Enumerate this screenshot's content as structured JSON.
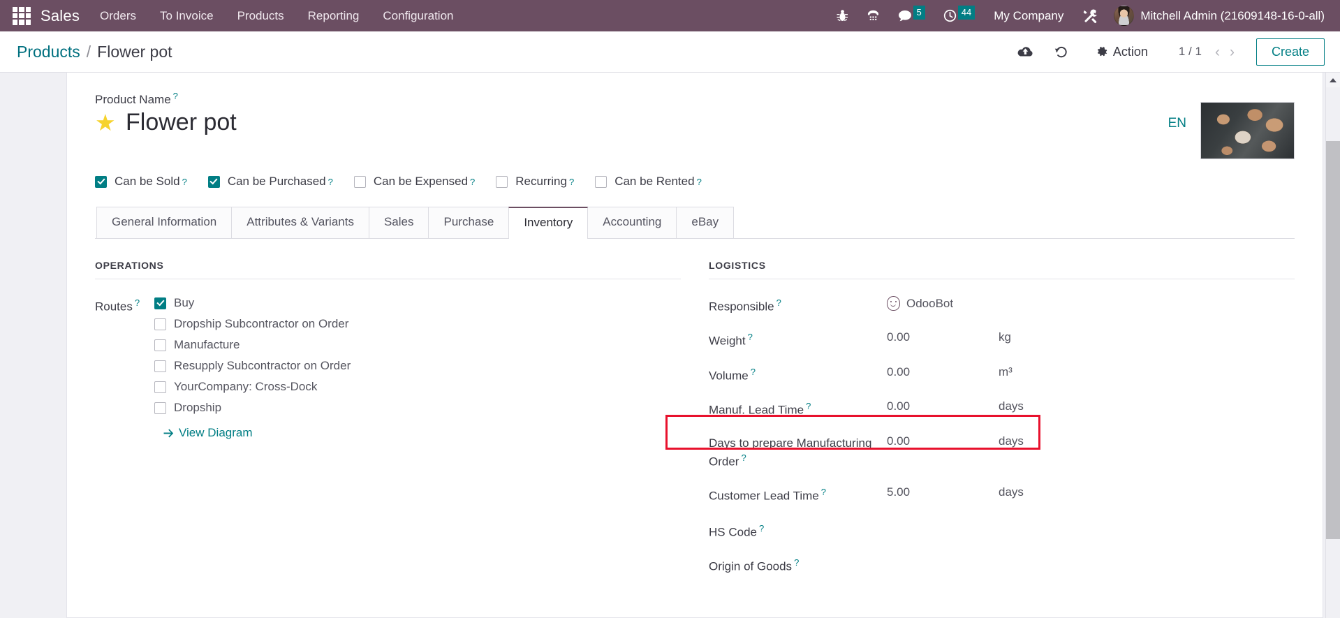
{
  "navbar": {
    "apps_icon": "apps-grid-icon",
    "brand": "Sales",
    "menu": [
      {
        "label": "Orders"
      },
      {
        "label": "To Invoice"
      },
      {
        "label": "Products"
      },
      {
        "label": "Reporting"
      },
      {
        "label": "Configuration"
      }
    ],
    "icons": [
      {
        "name": "bug-icon",
        "glyph": "🐞",
        "badge": null
      },
      {
        "name": "voip-phone-icon",
        "glyph": "☎",
        "badge": null
      },
      {
        "name": "messages-icon",
        "glyph": "💬",
        "badge": "5"
      },
      {
        "name": "activities-clock-icon",
        "glyph": "🕒",
        "badge": "44"
      }
    ],
    "company": "My Company",
    "tools_icon": "wrench-screwdriver-icon",
    "user": "Mitchell Admin (21609148-16-0-all)",
    "badge_color": "#017e84",
    "bg_color": "#6b4e62"
  },
  "control_panel": {
    "breadcrumb_root": "Products",
    "breadcrumb_sep": "/",
    "breadcrumb_current": "Flower pot",
    "upload_icon": "cloud-upload-icon",
    "discard_icon": "undo-discard-icon",
    "action_label": "Action",
    "action_icon": "gear-icon",
    "pager": "1 / 1",
    "prev_icon": "chevron-left-icon",
    "next_icon": "chevron-right-icon",
    "create_label": "Create",
    "accent_color": "#017e84"
  },
  "form": {
    "product_name_label": "Product Name",
    "product_name": "Flower pot",
    "favorite_star": "★",
    "language": "EN",
    "image_alt": "product-image-flower-pots",
    "checkboxes": [
      {
        "label": "Can be Sold",
        "checked": true
      },
      {
        "label": "Can be Purchased",
        "checked": true
      },
      {
        "label": "Can be Expensed",
        "checked": false
      },
      {
        "label": "Recurring",
        "checked": false
      },
      {
        "label": "Can be Rented",
        "checked": false
      }
    ],
    "tabs": [
      {
        "label": "General Information",
        "active": false
      },
      {
        "label": "Attributes & Variants",
        "active": false
      },
      {
        "label": "Sales",
        "active": false
      },
      {
        "label": "Purchase",
        "active": false
      },
      {
        "label": "Inventory",
        "active": true
      },
      {
        "label": "Accounting",
        "active": false
      },
      {
        "label": "eBay",
        "active": false
      }
    ],
    "operations": {
      "title": "Operations",
      "routes_label": "Routes",
      "routes": [
        {
          "label": "Buy",
          "checked": true
        },
        {
          "label": "Dropship Subcontractor on Order",
          "checked": false
        },
        {
          "label": "Manufacture",
          "checked": false
        },
        {
          "label": "Resupply Subcontractor on Order",
          "checked": false
        },
        {
          "label": "YourCompany: Cross-Dock",
          "checked": false
        },
        {
          "label": "Dropship",
          "checked": false
        }
      ],
      "view_diagram": "View Diagram",
      "arrow_icon": "arrow-right-icon"
    },
    "logistics": {
      "title": "Logistics",
      "responsible_label": "Responsible",
      "responsible_value": "OdooBot",
      "responsible_avatar": "odoobot-face-icon",
      "rows": [
        {
          "label": "Weight",
          "value": "0.00",
          "unit": "kg"
        },
        {
          "label": "Volume",
          "value": "0.00",
          "unit": "m³"
        },
        {
          "label": "Manuf. Lead Time",
          "value": "0.00",
          "unit": "days"
        },
        {
          "label": "Days to prepare Manufacturing Order",
          "value": "0.00",
          "unit": "days"
        },
        {
          "label": "Customer Lead Time",
          "value": "5.00",
          "unit": "days"
        }
      ],
      "hs_code_label": "HS Code",
      "hs_code_value": "",
      "origin_label": "Origin of Goods",
      "origin_value": ""
    },
    "highlight": {
      "color": "#e8112d",
      "target": "Customer Lead Time"
    }
  }
}
